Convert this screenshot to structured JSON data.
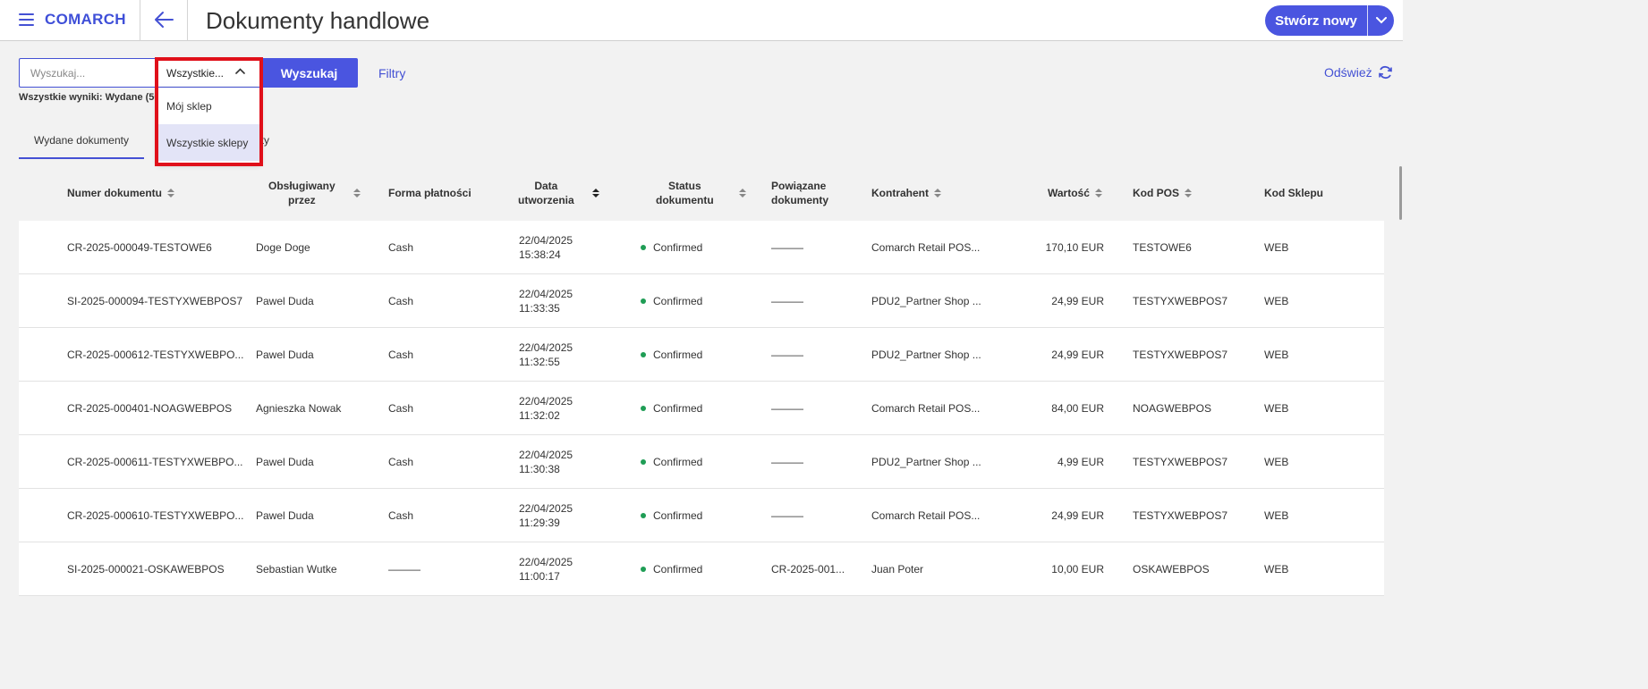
{
  "header": {
    "logo": "COMARCH",
    "title": "Dokumenty handlowe",
    "create_button": "Stwórz nowy"
  },
  "search": {
    "placeholder": "Wyszukaj...",
    "scope_value": "Wszystkie...",
    "button": "Wyszukaj",
    "filters": "Filtry",
    "refresh": "Odśwież",
    "results_summary": "Wszystkie wyniki: Wydane (50"
  },
  "dropdown": {
    "options": [
      "Mój sklep",
      "Wszystkie sklepy"
    ],
    "selected": "Wszystkie sklepy"
  },
  "tabs": {
    "issued": "Wydane dokumenty",
    "second_partial": "nty"
  },
  "table": {
    "headers": {
      "number": "Numer dokumentu",
      "served_by_1": "Obsługiwany",
      "served_by_2": "przez",
      "payment": "Forma płatności",
      "date_1": "Data",
      "date_2": "utworzenia",
      "status_1": "Status",
      "status_2": "dokumentu",
      "related_1": "Powiązane",
      "related_2": "dokumenty",
      "contractor": "Kontrahent",
      "value": "Wartość",
      "pos": "Kod POS",
      "shop": "Kod Sklepu"
    },
    "rows": [
      {
        "number": "CR-2025-000049-TESTOWE6",
        "served_by": "Doge Doge",
        "payment": "Cash",
        "date": "22/04/2025",
        "time": "15:38:24",
        "status": "Confirmed",
        "related": "———",
        "contractor": "Comarch Retail POS...",
        "value": "170,10 EUR",
        "pos": "TESTOWE6",
        "shop": "WEB"
      },
      {
        "number": "SI-2025-000094-TESTYXWEBPOS7",
        "served_by": "Pawel Duda",
        "payment": "Cash",
        "date": "22/04/2025",
        "time": "11:33:35",
        "status": "Confirmed",
        "related": "———",
        "contractor": "PDU2_Partner Shop ...",
        "value": "24,99 EUR",
        "pos": "TESTYXWEBPOS7",
        "shop": "WEB"
      },
      {
        "number": "CR-2025-000612-TESTYXWEBPO...",
        "served_by": "Pawel Duda",
        "payment": "Cash",
        "date": "22/04/2025",
        "time": "11:32:55",
        "status": "Confirmed",
        "related": "———",
        "contractor": "PDU2_Partner Shop ...",
        "value": "24,99 EUR",
        "pos": "TESTYXWEBPOS7",
        "shop": "WEB"
      },
      {
        "number": "CR-2025-000401-NOAGWEBPOS",
        "served_by": "Agnieszka Nowak",
        "payment": "Cash",
        "date": "22/04/2025",
        "time": "11:32:02",
        "status": "Confirmed",
        "related": "———",
        "contractor": "Comarch Retail POS...",
        "value": "84,00 EUR",
        "pos": "NOAGWEBPOS",
        "shop": "WEB"
      },
      {
        "number": "CR-2025-000611-TESTYXWEBPO...",
        "served_by": "Pawel Duda",
        "payment": "Cash",
        "date": "22/04/2025",
        "time": "11:30:38",
        "status": "Confirmed",
        "related": "———",
        "contractor": "PDU2_Partner Shop ...",
        "value": "4,99 EUR",
        "pos": "TESTYXWEBPOS7",
        "shop": "WEB"
      },
      {
        "number": "CR-2025-000610-TESTYXWEBPO...",
        "served_by": "Pawel Duda",
        "payment": "Cash",
        "date": "22/04/2025",
        "time": "11:29:39",
        "status": "Confirmed",
        "related": "———",
        "contractor": "Comarch Retail POS...",
        "value": "24,99 EUR",
        "pos": "TESTYXWEBPOS7",
        "shop": "WEB"
      },
      {
        "number": "SI-2025-000021-OSKAWEBPOS",
        "served_by": "Sebastian Wutke",
        "payment": "———",
        "date": "22/04/2025",
        "time": "11:00:17",
        "status": "Confirmed",
        "related": "CR-2025-001...",
        "contractor": "Juan Poter",
        "value": "10,00 EUR",
        "pos": "OSKAWEBPOS",
        "shop": "WEB"
      }
    ]
  },
  "colors": {
    "accent": "#4a55e0",
    "status_confirmed": "#1f9d55",
    "highlight": "#e0101a"
  }
}
